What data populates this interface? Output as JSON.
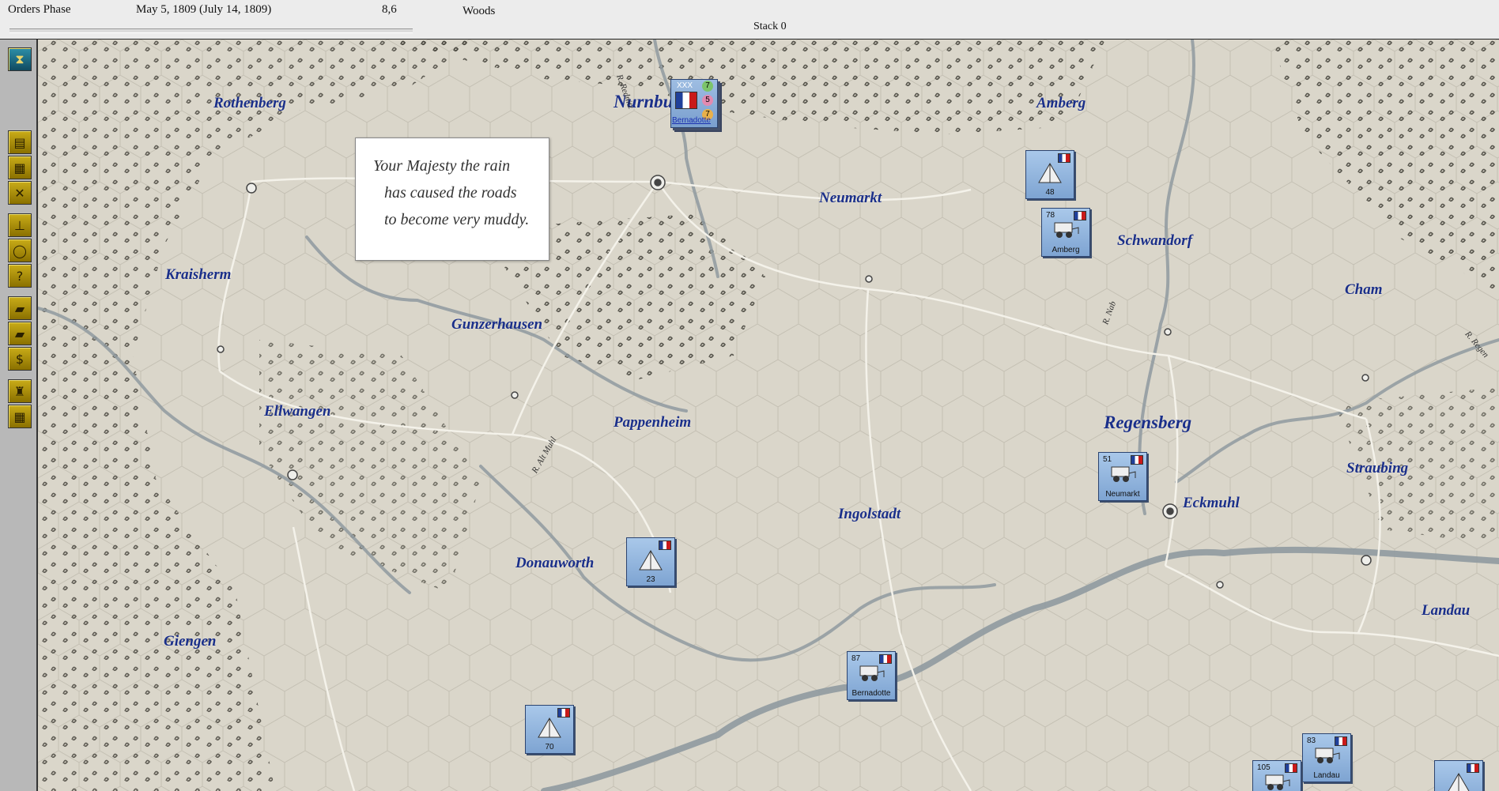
{
  "topbar": {
    "phase": "Orders Phase",
    "date": "May 5, 1809 (July 14, 1809)",
    "coord": "8,6",
    "terrain": "Woods",
    "stack": "Stack 0"
  },
  "sidebar": {
    "buttons": [
      {
        "icon": "hourglass-icon",
        "glyph": "⧗"
      },
      {
        "icon": "ledger-icon",
        "glyph": "▤"
      },
      {
        "icon": "stack-icon",
        "glyph": "▦"
      },
      {
        "icon": "crossed-swords-icon",
        "glyph": "✕"
      },
      {
        "icon": "org-chart-icon",
        "glyph": "⊥"
      },
      {
        "icon": "ring-icon",
        "glyph": "◯"
      },
      {
        "icon": "help-icon",
        "glyph": "?"
      },
      {
        "icon": "gold-bars-icon",
        "glyph": "▰"
      },
      {
        "icon": "gold-bars-plus-icon",
        "glyph": "▰"
      },
      {
        "icon": "dollar-icon",
        "glyph": "$"
      },
      {
        "icon": "trophy-icon",
        "glyph": "♜"
      },
      {
        "icon": "grid-icon",
        "glyph": "▦"
      }
    ]
  },
  "message": {
    "lines": [
      "Your Majesty the rain",
      "has caused  the roads",
      "to become very muddy."
    ]
  },
  "cities": [
    {
      "name": "Rothenberg"
    },
    {
      "name": "Nurnburg"
    },
    {
      "name": "Amberg"
    },
    {
      "name": "Neumarkt"
    },
    {
      "name": "Schwandorf"
    },
    {
      "name": "Kraisherm"
    },
    {
      "name": "Cham"
    },
    {
      "name": "Gunzerhausen"
    },
    {
      "name": "Ellwangen"
    },
    {
      "name": "Pappenheim"
    },
    {
      "name": "Regensberg"
    },
    {
      "name": "Straubing"
    },
    {
      "name": "Eckmuhl"
    },
    {
      "name": "Ingolstadt"
    },
    {
      "name": "Donauworth"
    },
    {
      "name": "Landau"
    },
    {
      "name": "Giengen"
    }
  ],
  "rivers": [
    {
      "name": "R. Rednitz"
    },
    {
      "name": "R. Nab"
    },
    {
      "name": "R. Alt Muhl"
    },
    {
      "name": "R. Regen"
    }
  ],
  "units": [
    {
      "type": "depot",
      "num": "",
      "label": "48"
    },
    {
      "type": "supply",
      "num": "78",
      "label": "Amberg"
    },
    {
      "type": "supply",
      "num": "51",
      "label": "Neumarkt"
    },
    {
      "type": "depot",
      "num": "",
      "label": "23"
    },
    {
      "type": "supply",
      "num": "87",
      "label": "Bernadotte"
    },
    {
      "type": "depot",
      "num": "",
      "label": "70"
    },
    {
      "type": "supply",
      "num": "83",
      "label": "Landau"
    },
    {
      "type": "supply",
      "num": "105",
      "label": ""
    },
    {
      "type": "depot",
      "num": "",
      "label": ""
    }
  ],
  "corps": {
    "label": "Bernadotte",
    "size": "XXX",
    "values": [
      "7",
      "5",
      "7"
    ]
  },
  "colors": {
    "city_text": "#1a2f8a",
    "river": "#8f9aa0",
    "unit_bg": "#8fb4de",
    "badge_green": "#7cc46a",
    "badge_pink": "#e28ab0",
    "badge_orange": "#e8b04a"
  }
}
